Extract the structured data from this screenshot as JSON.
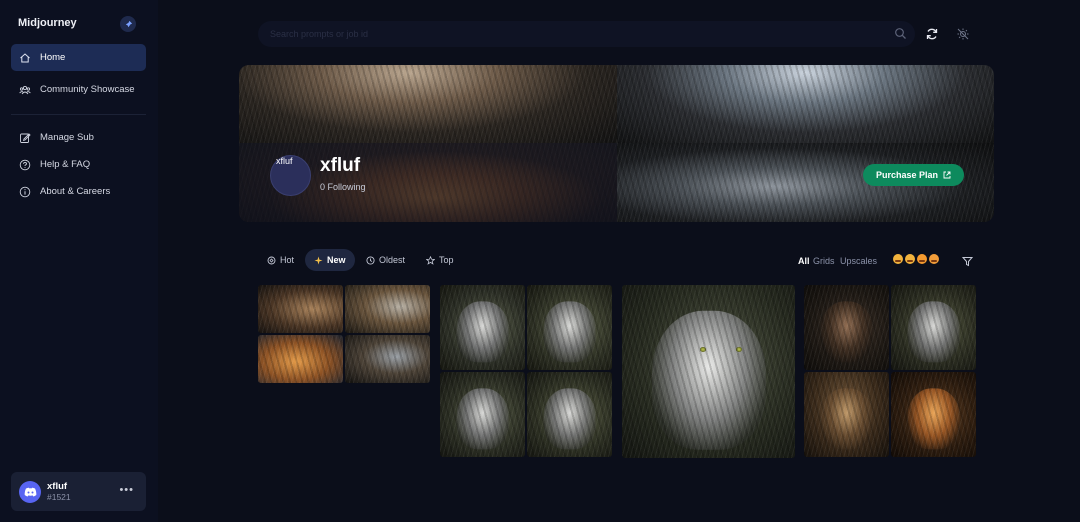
{
  "sidebar": {
    "brand": "Midjourney",
    "nav": [
      {
        "label": "Home",
        "icon": "home-icon",
        "active": true
      },
      {
        "label": "Community Showcase",
        "icon": "community-icon",
        "active": false
      },
      {
        "label": "Manage Sub",
        "icon": "edit-icon",
        "active": false
      },
      {
        "label": "Help & FAQ",
        "icon": "help-icon",
        "active": false
      },
      {
        "label": "About & Careers",
        "icon": "info-icon",
        "active": false
      }
    ],
    "user": {
      "name": "xfluf",
      "tag": "#1521",
      "more": "•••"
    }
  },
  "search": {
    "placeholder": "Search prompts or job id"
  },
  "profile": {
    "avatar_text": "xfluf",
    "name": "xfluf",
    "following": "0 Following",
    "purchase_label": "Purchase Plan"
  },
  "filters": {
    "sort": [
      "Hot",
      "New",
      "Oldest",
      "Top"
    ],
    "active_sort": "New",
    "view": [
      "All",
      "Grids",
      "Upscales"
    ],
    "active_view": "All"
  },
  "colors": {
    "background": "#0b0e1a",
    "sidebar": "#0c1020",
    "active_nav": "#1d2c55",
    "purchase": "#0d8a5d",
    "discord": "#5865f2"
  }
}
